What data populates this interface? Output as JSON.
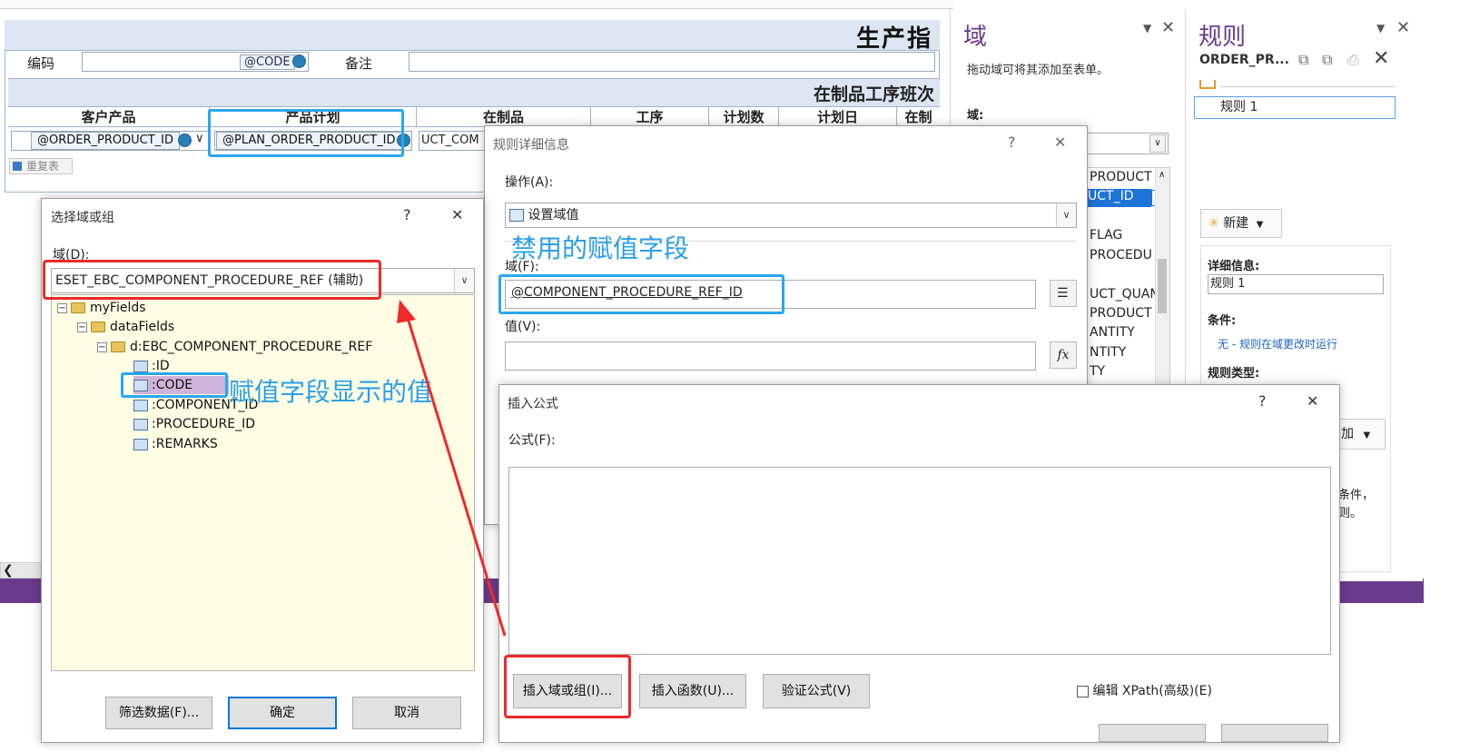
{
  "form": {
    "title": "生产指",
    "row1": {
      "code_label": "编码",
      "code_tag": "@CODE",
      "remark_label": "备注"
    },
    "section_title": "在制品工序班次",
    "columns": [
      "客户产品",
      "产品计划",
      "在制品",
      "工序",
      "计划数",
      "计划日",
      "在制"
    ],
    "fields": {
      "order_product_id": "@ORDER_PRODUCT_ID",
      "plan_order_product_id": "@PLAN_ORDER_PRODUCT_ID",
      "partial_component": "UCT_COM"
    },
    "repeat_button": "重复表"
  },
  "domain_panel": {
    "title": "域",
    "hint": "拖动域可将其添加至表单。",
    "domain_label": "域:",
    "partial_items": [
      "PRODUCT",
      "UCT_ID",
      "FLAG",
      "PROCEDU",
      "UCT_QUAN",
      "PRODUCT",
      "ANTITY",
      "NTITY",
      "TY"
    ]
  },
  "rules_panel": {
    "title": "规则",
    "field_name": "ORDER_PR...",
    "rule_item": "规则 1",
    "new_button": "新建",
    "details_label": "详细信息:",
    "details_value": "规则 1",
    "condition_label": "条件:",
    "condition_value": "无 - 规则在域更改时运行",
    "rule_type_label": "规则类型:",
    "add_partial": "加",
    "side_text_1": "条件，",
    "side_text_2": "则。"
  },
  "dialog_select": {
    "title": "选择域或组",
    "help": "?",
    "close": "✕",
    "domain_label": "域(D):",
    "domain_value": "ESET_EBC_COMPONENT_PROCEDURE_REF (辅助)",
    "tree": {
      "root": "myFields",
      "data_fields": "dataFields",
      "group": "d:EBC_COMPONENT_PROCEDURE_REF",
      "fields": [
        ":ID",
        ":CODE",
        ":COMPONENT_ID",
        ":PROCEDURE_ID",
        ":REMARKS"
      ]
    },
    "filter_button": "筛选数据(F)...",
    "ok_button": "确定",
    "cancel_button": "取消"
  },
  "dialog_rule": {
    "title": "规则详细信息",
    "help": "?",
    "close": "✕",
    "action_label": "操作(A):",
    "action_value": "设置域值",
    "field_label": "域(F):",
    "field_value": "@COMPONENT_PROCEDURE_REF_ID",
    "value_label": "值(V):",
    "fx_label": "fx"
  },
  "dialog_formula": {
    "title": "插入公式",
    "help": "?",
    "close": "✕",
    "formula_label": "公式(F):",
    "insert_field_button": "插入域或组(I)...",
    "insert_function_button": "插入函数(U)...",
    "verify_button": "验证公式(V)",
    "xpath_label": "编辑 XPath(高级)(E)"
  },
  "annotations": {
    "disabled_field": "禁用的赋值字段",
    "display_value": "赋值字段显示的值"
  },
  "colors": {
    "accent_purple": "#6a3a8c",
    "annotation_red": "#ee2a2a",
    "annotation_blue": "#29a7f0"
  }
}
